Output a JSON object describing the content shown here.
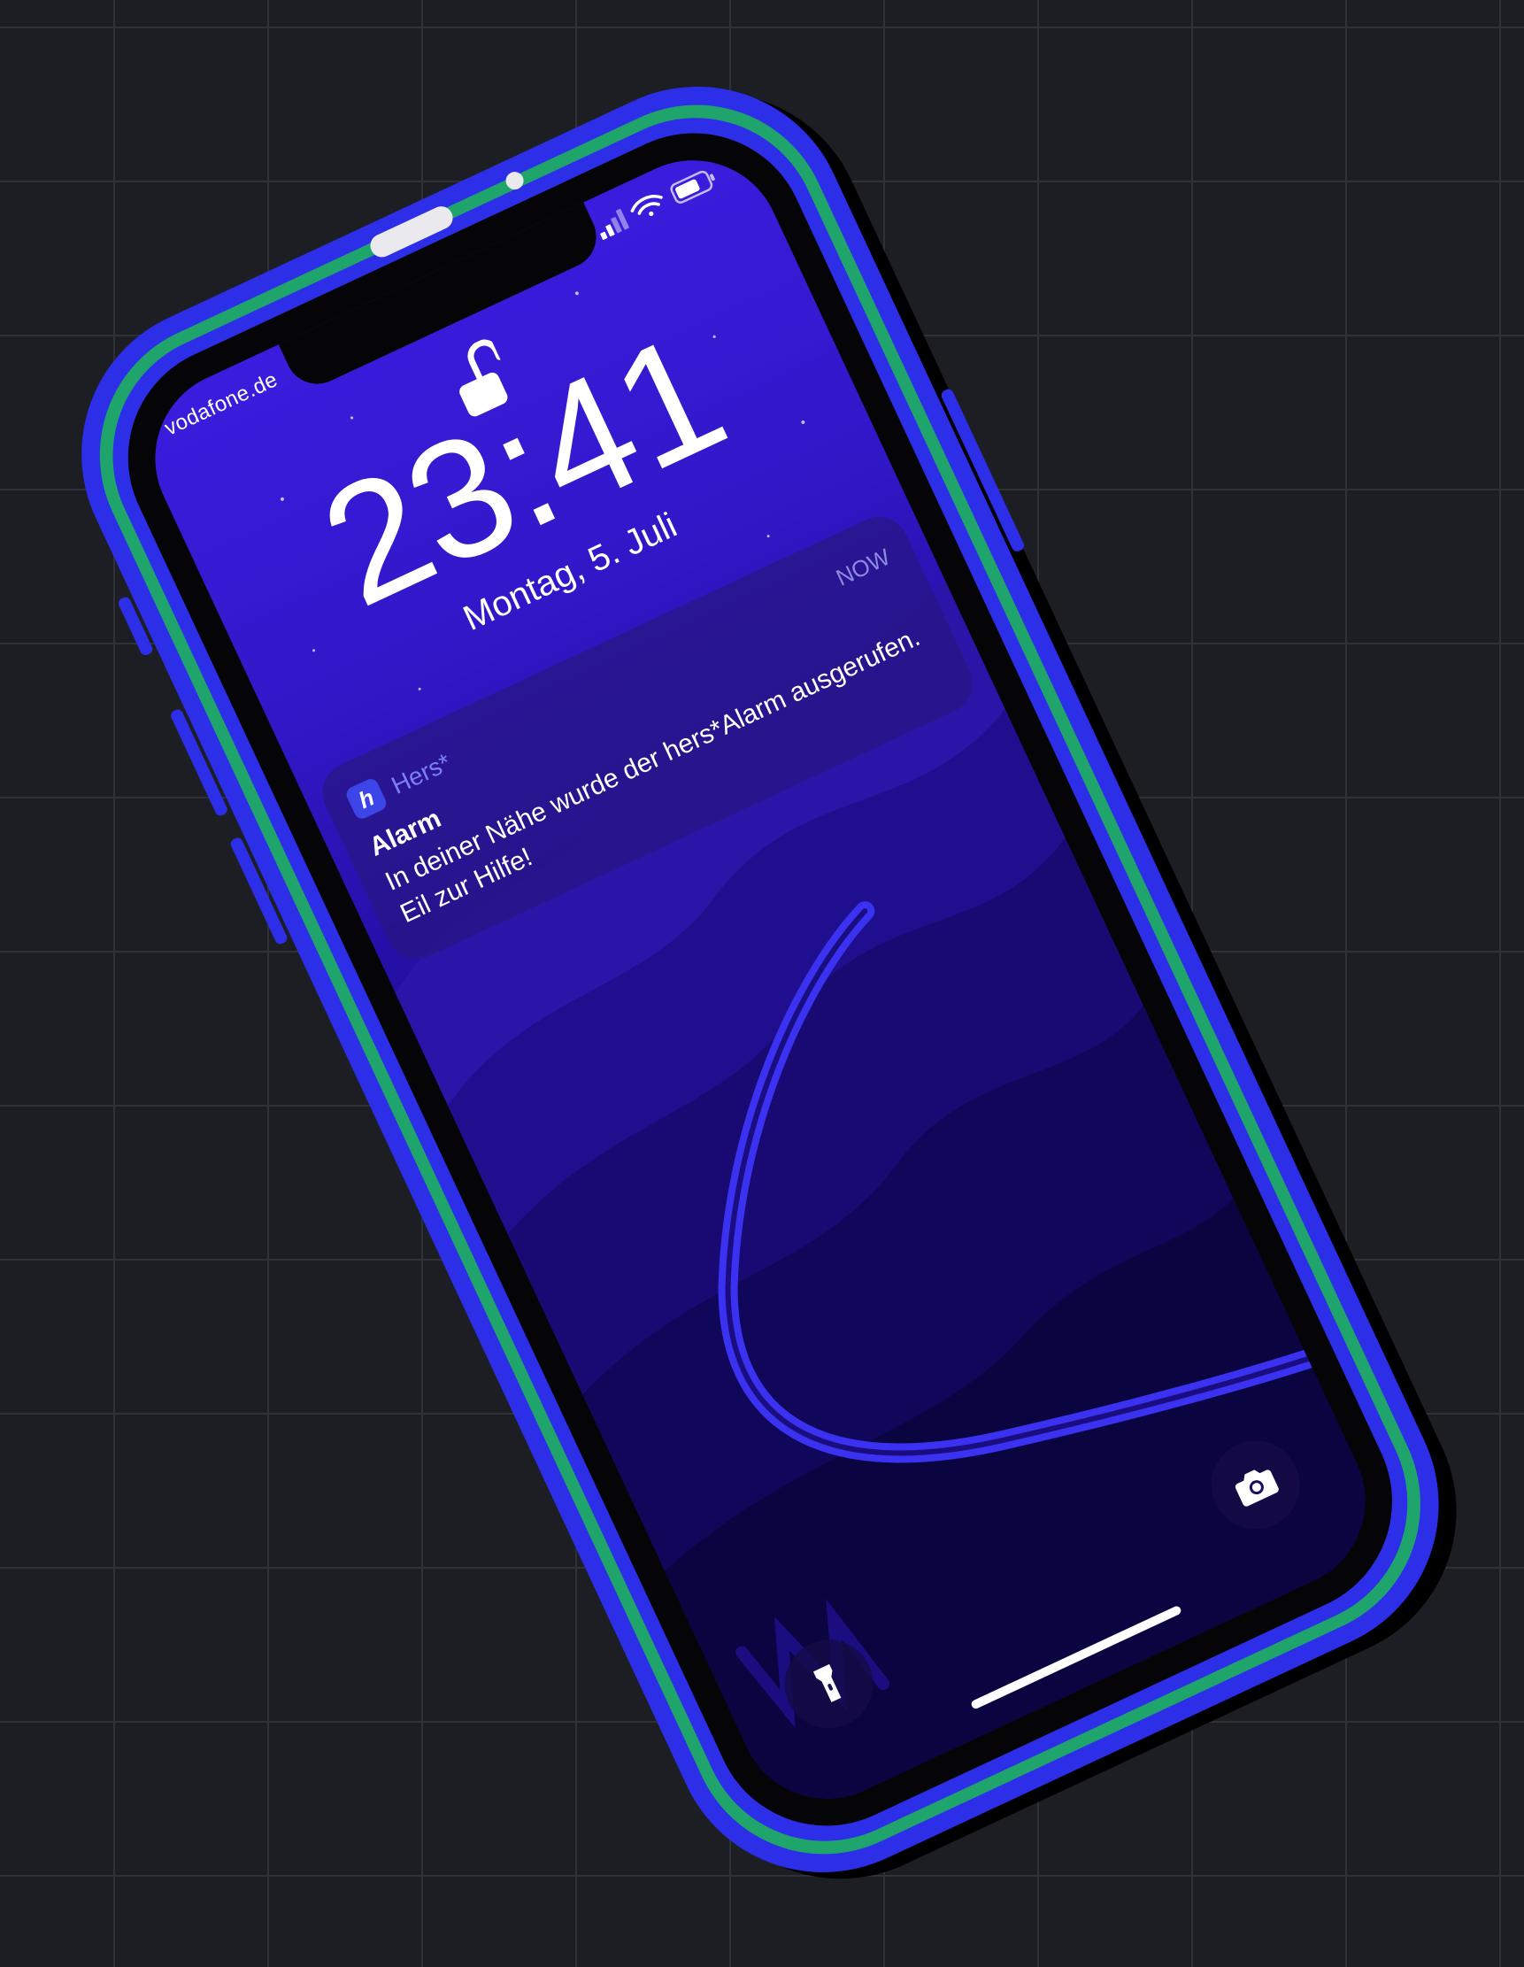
{
  "colors": {
    "case_blue": "#2d2ee8",
    "case_green": "#1fa56c",
    "background": "#1c1e23",
    "screen_top": "#3a1cde",
    "screen_bottom": "#0b0440",
    "app_accent": "#3b45e8"
  },
  "status_bar": {
    "carrier": "vodafone.de",
    "icons": [
      "cellular-signal-icon",
      "wifi-icon",
      "battery-icon"
    ]
  },
  "lock_screen": {
    "lock_state": "unlocked",
    "lock_icon": "unlocked-padlock-icon",
    "time": "23:41",
    "date": "Montag, 5. Juli"
  },
  "notification": {
    "app_icon_glyph": "h",
    "app_name": "Hers*",
    "time": "NOW",
    "title": "Alarm",
    "body": "In deiner Nähe wurde der hers*Alarm ausgerufen. Eil zur Hilfe!"
  },
  "quick_actions": {
    "left_icon": "flashlight-icon",
    "right_icon": "camera-icon"
  }
}
